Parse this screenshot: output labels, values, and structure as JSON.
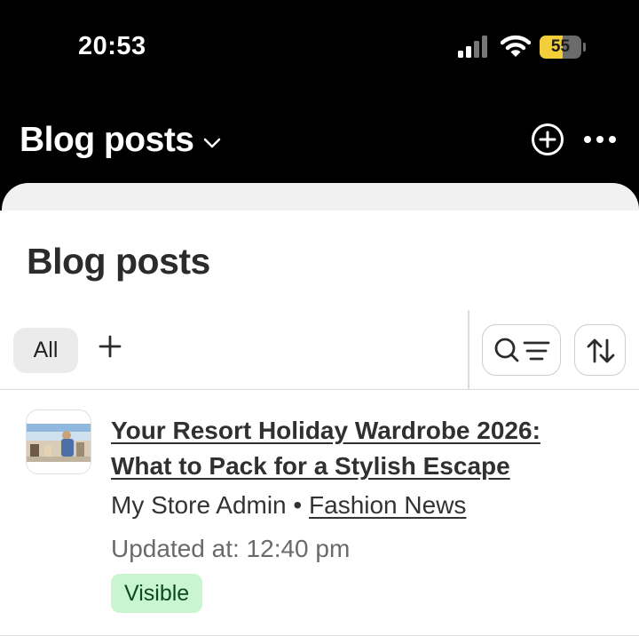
{
  "status_bar": {
    "time": "20:53",
    "battery": "55",
    "battery_level": 0.55
  },
  "header": {
    "title": "Blog posts",
    "icons": [
      "chevron-down-icon",
      "add-circle-icon",
      "more-icon"
    ]
  },
  "page": {
    "title": "Blog posts"
  },
  "tabs": {
    "all_label": "All",
    "icons": [
      "plus-icon",
      "search-filter-icon",
      "sort-icon"
    ]
  },
  "post": {
    "title": "Your Resort Holiday Wardrobe 2026: What to Pack for a Stylish Escape",
    "author": "My Store Admin",
    "separator": "•",
    "category": "Fashion News",
    "updated": "Updated at: 12:40 pm",
    "status": "Visible"
  },
  "colors": {
    "badge_bg": "#c9f5cf",
    "badge_text": "#0b4a20",
    "battery_fill": "#f2cf3a"
  }
}
